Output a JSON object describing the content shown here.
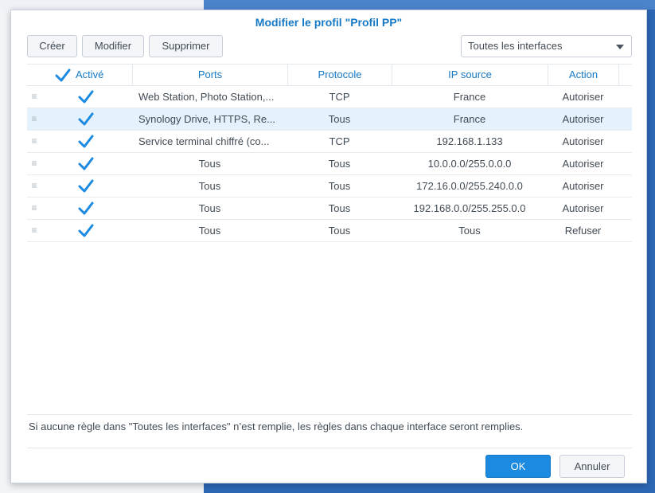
{
  "dialog": {
    "title": "Modifier le profil \"Profil PP\""
  },
  "toolbar": {
    "create_label": "Créer",
    "modify_label": "Modifier",
    "delete_label": "Supprimer",
    "interface_select": "Toutes les interfaces"
  },
  "table": {
    "headers": {
      "enabled": "Activé",
      "ports": "Ports",
      "protocol": "Protocole",
      "source_ip": "IP source",
      "action": "Action"
    },
    "rows": [
      {
        "handle": "≡",
        "enabled": true,
        "ports": "Web Station, Photo Station,...",
        "protocol": "TCP",
        "source_ip": "France",
        "action": "Autoriser"
      },
      {
        "handle": "≡",
        "enabled": true,
        "ports": "Synology Drive, HTTPS, Re...",
        "protocol": "Tous",
        "source_ip": "France",
        "action": "Autoriser"
      },
      {
        "handle": "≡",
        "enabled": true,
        "ports": "Service terminal chiffré (co...",
        "protocol": "TCP",
        "source_ip": "192.168.1.133",
        "action": "Autoriser"
      },
      {
        "handle": "≡",
        "enabled": true,
        "ports": "Tous",
        "protocol": "Tous",
        "source_ip": "10.0.0.0/255.0.0.0",
        "action": "Autoriser"
      },
      {
        "handle": "≡",
        "enabled": true,
        "ports": "Tous",
        "protocol": "Tous",
        "source_ip": "172.16.0.0/255.240.0.0",
        "action": "Autoriser"
      },
      {
        "handle": "≡",
        "enabled": true,
        "ports": "Tous",
        "protocol": "Tous",
        "source_ip": "192.168.0.0/255.255.0.0",
        "action": "Autoriser"
      },
      {
        "handle": "≡",
        "enabled": true,
        "ports": "Tous",
        "protocol": "Tous",
        "source_ip": "Tous",
        "action": "Refuser"
      }
    ]
  },
  "note": "Si aucune règle dans \"Toutes les interfaces\" n’est remplie, les règles dans chaque interface seront remplies.",
  "footer": {
    "ok_label": "OK",
    "cancel_label": "Annuler"
  },
  "colors": {
    "accent": "#1679c5",
    "check": "#1b8ae0",
    "selected_row": "#e5f1fc",
    "desktop": "#2d68b5"
  }
}
